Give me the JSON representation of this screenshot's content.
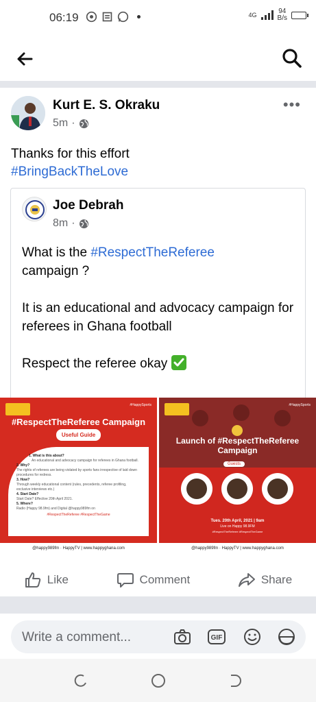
{
  "status_bar": {
    "time": "06:19",
    "network": "4G",
    "speed_value": "94",
    "speed_unit": "B/s"
  },
  "post": {
    "author": "Kurt E. S. Okraku",
    "time_ago": "5m",
    "dot": "·",
    "text": "Thanks for this effort",
    "hashtag": "#BringBackTheLove",
    "more": "•••",
    "shared_post": {
      "author": "Joe Debrah",
      "time_ago": "8m",
      "question_prefix": "What is the ",
      "question_hashtag": "#RespectTheReferee",
      "question_suffix": "campaign ?",
      "answer": "It is an educational and advocacy campaign for referees in Ghana football",
      "closing": "Respect the referee okay"
    },
    "images": [
      {
        "title": "#RespectTheReferee Campaign",
        "subtitle": "Useful Guide",
        "q1": "1. What is this about?",
        "a1": "An educational and advocacy campaign for referees in Ghana football.",
        "q2": "2. Why?",
        "a2": "The rights of referees are being violated by sports fans irrespective of laid down procedures for redress.",
        "q3": "3. How?",
        "a3": "Through weekly educational content (rules, precedents, referee profiling, exclusive interviews etc.)",
        "q4": "4. Start Date?",
        "a4": "Start Date? Effective 20th April 2021.",
        "q5": "5. Where?",
        "a5": "Radio (Happy 98.9fm) and Digital @happy989fm on",
        "tags": "#RespectTheReferee #RespectTheGame",
        "footer": "@happy989fm · HappyTV | www.happyghana.com"
      },
      {
        "title": "Launch of #RespectTheReferee Campaign",
        "subtitle": "Guests",
        "date": "Tues. 20th April, 2021 | 9am",
        "live": "Live on Happy 98.9FM",
        "tags": "#RespectTheReferee #RespectTheGame",
        "footer": "@happy989fm · HappyTV | www.happyghana.com",
        "brand": "#HappySports"
      }
    ],
    "actions": {
      "like": "Like",
      "comment": "Comment",
      "share": "Share"
    }
  },
  "comment_bar": {
    "placeholder": "Write a comment..."
  },
  "colors": {
    "link": "#2d6bd4",
    "meta": "#65676b",
    "campaign_red": "#d52b20"
  }
}
